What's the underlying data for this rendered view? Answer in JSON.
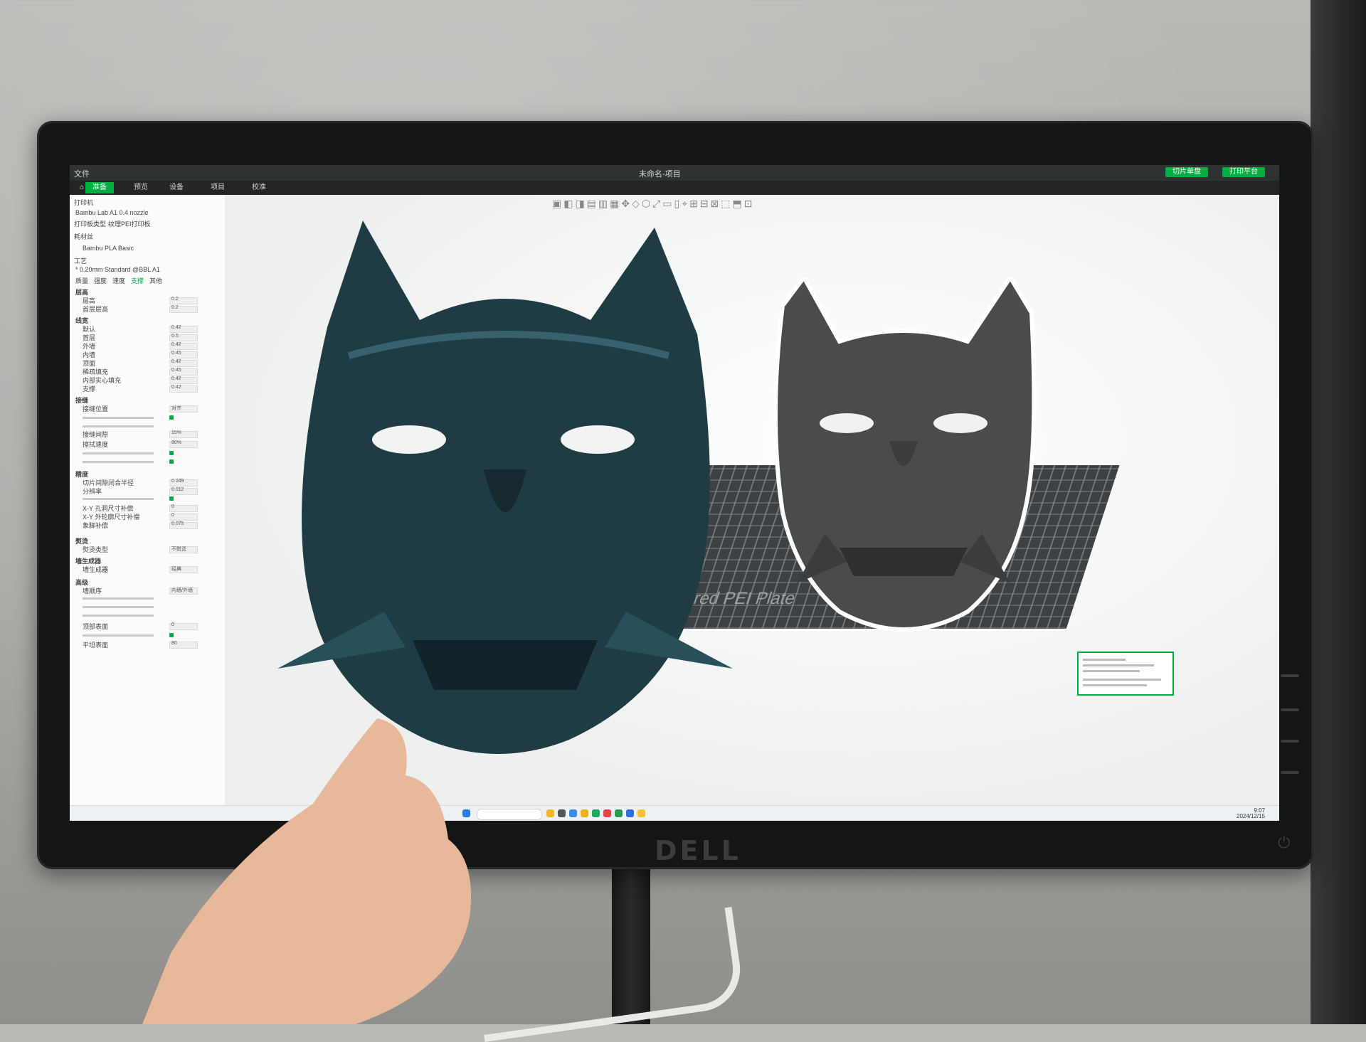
{
  "monitor": {
    "brand": "DELL"
  },
  "window": {
    "title": "未命名-项目",
    "menu": "文件"
  },
  "tabs": [
    {
      "label": "准备"
    },
    {
      "label": "预览"
    },
    {
      "label": "设备"
    },
    {
      "label": "项目"
    },
    {
      "label": "校准"
    }
  ],
  "actions": {
    "slice": "切片单盘",
    "print": "打印平台"
  },
  "sidebar": {
    "printer_header": "打印机",
    "printer_name": "Bambu Lab A1 0.4 nozzle",
    "plate_type_label": "打印板类型",
    "plate_type_value": "纹理PEI打印板",
    "filament_header": "耗材丝",
    "filament_name": "Bambu PLA Basic",
    "process_header": "工艺",
    "process_profile": "* 0.20mm Standard @BBL A1",
    "section_tabs": [
      "质量",
      "强度",
      "速度",
      "支撑",
      "其他"
    ],
    "groups": [
      {
        "title": "层高",
        "rows": [
          {
            "label": "层高",
            "value": "0.2"
          },
          {
            "label": "首层层高",
            "value": "0.2"
          }
        ]
      },
      {
        "title": "线宽",
        "rows": [
          {
            "label": "默认",
            "value": "0.42"
          },
          {
            "label": "首层",
            "value": "0.5"
          },
          {
            "label": "外墙",
            "value": "0.42"
          },
          {
            "label": "内墙",
            "value": "0.45"
          },
          {
            "label": "顶面",
            "value": "0.42"
          },
          {
            "label": "稀疏填充",
            "value": "0.45"
          },
          {
            "label": "内部实心填充",
            "value": "0.42"
          },
          {
            "label": "支撑",
            "value": "0.42"
          }
        ]
      },
      {
        "title": "接缝",
        "rows": [
          {
            "label": "接缝位置",
            "value": "对齐"
          },
          {
            "label": "接缝间隙",
            "value": "15%"
          },
          {
            "label": "擦拭速度",
            "value": "80%"
          }
        ]
      },
      {
        "title": "精度",
        "rows": [
          {
            "label": "切片间隙闭合半径",
            "value": "0.049"
          },
          {
            "label": "分辨率",
            "value": "0.012"
          },
          {
            "label": "X-Y 孔洞尺寸补偿",
            "value": "0"
          },
          {
            "label": "X-Y 外轮廓尺寸补偿",
            "value": "0"
          },
          {
            "label": "象脚补偿",
            "value": "0.075"
          }
        ]
      },
      {
        "title": "熨烫",
        "rows": [
          {
            "label": "熨烫类型",
            "value": "不熨烫"
          }
        ]
      },
      {
        "title": "墙生成器",
        "rows": [
          {
            "label": "墙生成器",
            "value": "经典"
          }
        ]
      },
      {
        "title": "高级",
        "rows": [
          {
            "label": "墙顺序",
            "value": "内墙/外墙"
          },
          {
            "label": "顶部表面",
            "value": "0"
          },
          {
            "label": "平坦表面",
            "value": "80"
          }
        ]
      }
    ]
  },
  "viewport": {
    "plate_label": "Bambu Textured PEI Plate"
  },
  "taskbar": {
    "search_placeholder": "搜索",
    "time": "9:07",
    "date": "2024/12/15"
  },
  "colors": {
    "accent": "#00ae42",
    "mask_print": "#1f3b44",
    "mask_model": "#4a4b4d"
  }
}
